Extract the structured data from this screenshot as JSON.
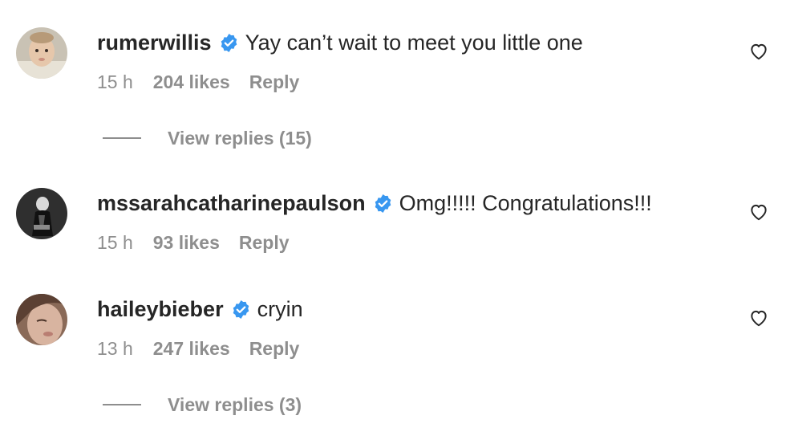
{
  "comments": [
    {
      "username": "rumerwillis",
      "text": "Yay can’t wait to meet you little one",
      "time": "15 h",
      "likes": "204 likes",
      "reply": "Reply",
      "view_replies": "View replies (15)",
      "verified": true
    },
    {
      "username": "mssarahcatharinepaulson",
      "text": "Omg!!!!! Congratulations!!!",
      "time": "15 h",
      "likes": "93 likes",
      "reply": "Reply",
      "verified": true
    },
    {
      "username": "haileybieber",
      "text": "cryin",
      "time": "13 h",
      "likes": "247 likes",
      "reply": "Reply",
      "view_replies": "View replies (3)",
      "verified": true
    }
  ],
  "icons": {
    "verified": "verified-badge-icon",
    "like": "heart-outline-icon"
  },
  "colors": {
    "verified_blue": "#3897f0",
    "text_primary": "#262626",
    "text_secondary": "#8e8e8e"
  }
}
